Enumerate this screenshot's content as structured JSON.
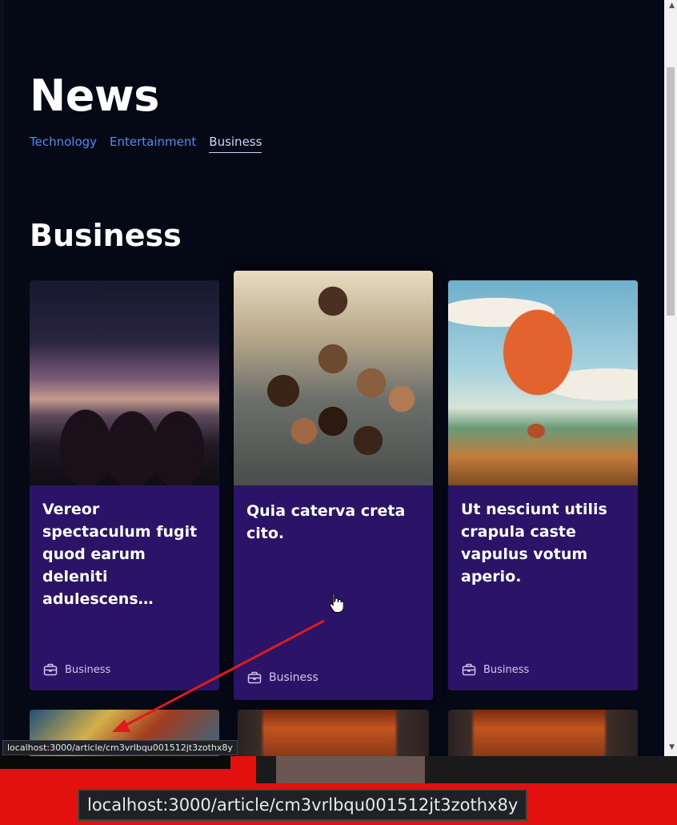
{
  "page": {
    "title": "News",
    "section_title": "Business"
  },
  "tabs": [
    {
      "label": "Technology",
      "active": false
    },
    {
      "label": "Entertainment",
      "active": false
    },
    {
      "label": "Business",
      "active": true
    }
  ],
  "cards": [
    {
      "title": "Vereor spectaculum fugit quod earum deleniti adulescens…",
      "category": "Business",
      "image": "friends-sitting-at-dusk-image"
    },
    {
      "title": "Quia caterva creta cito.",
      "category": "Business",
      "image": "group-of-kids-illustration-image"
    },
    {
      "title": "Ut nesciunt utilis crapula caste vapulus votum aperio.",
      "category": "Business",
      "image": "hot-air-balloon-image"
    }
  ],
  "status": {
    "url": "localhost:3000/article/cm3vrlbqu001512jt3zothx8y",
    "zoom_url": "localhost:3000/article/cm3vrlbqu001512jt3zothx8y"
  },
  "colors": {
    "background": "#050815",
    "card": "#2b1467",
    "tab_link": "#4b8cf5",
    "annotation_arrow": "#e01a1a"
  }
}
